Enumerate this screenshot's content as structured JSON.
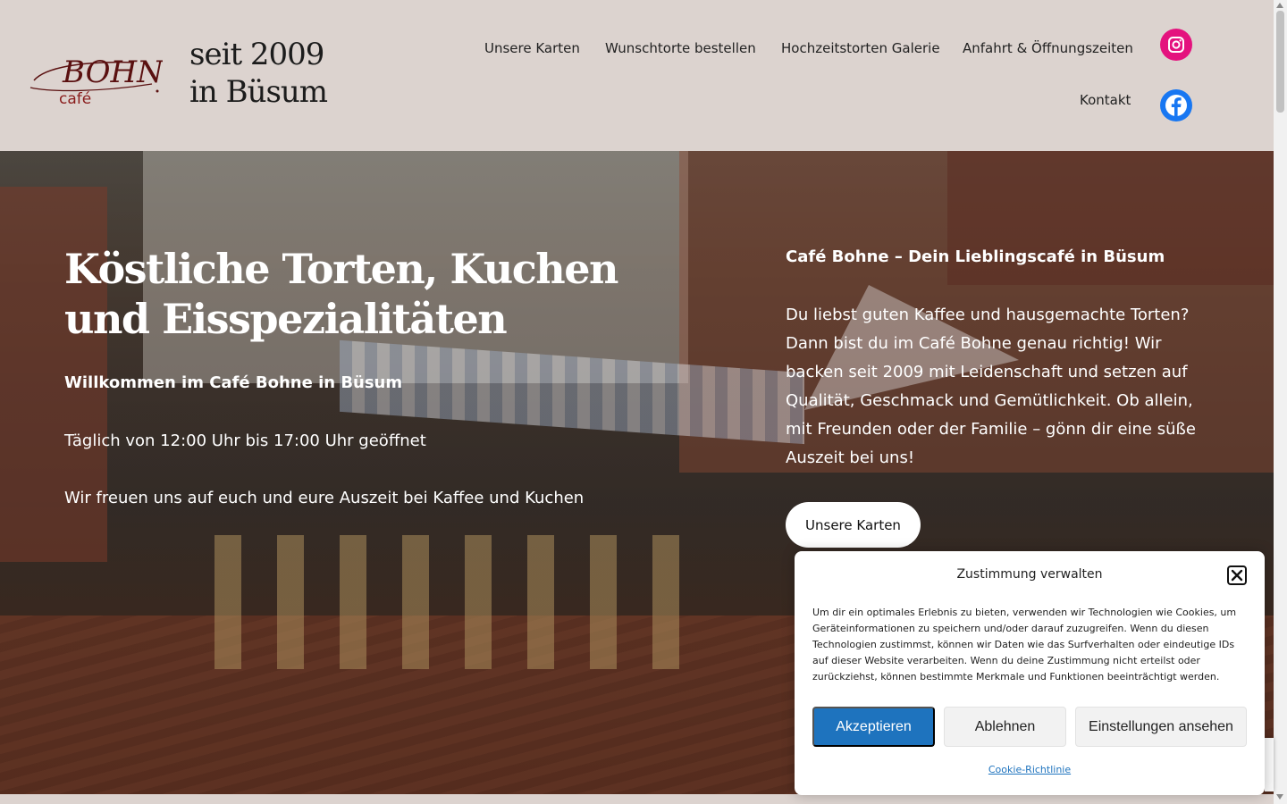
{
  "header": {
    "logo_main": "BOHNE",
    "logo_sub": "café",
    "tagline_line1": "seit 2009",
    "tagline_line2": "in Büsum"
  },
  "nav": {
    "items": [
      {
        "label": "Unsere Karten"
      },
      {
        "label": "Wunschtorte bestellen"
      },
      {
        "label": "Hochzeitstorten Galerie"
      },
      {
        "label": "Anfahrt & Öffnungszeiten"
      },
      {
        "label": "Kontakt"
      }
    ],
    "social": [
      {
        "icon": "instagram-icon",
        "color": "#e4127e"
      },
      {
        "icon": "facebook-icon",
        "color": "#1877f2"
      }
    ]
  },
  "hero": {
    "title_line1": "Köstliche Torten, Kuchen",
    "title_line2": "und Eisspezialitäten",
    "subtitle": "Willkommen im Café Bohne in Büsum",
    "hours": "Täglich von 12:00 Uhr bis 17:00 Uhr geöffnet",
    "welcome": "Wir freuen uns auf euch und eure Auszeit bei Kaffee und Kuchen",
    "right_title": "Café Bohne – Dein Lieblingscafé in Büsum",
    "right_text": "Du liebst guten Kaffee und hausgemachte Torten? Dann bist du im Café Bohne genau richtig! Wir backen seit 2009 mit Leidenschaft und setzen auf Qualität, Geschmack und Gemütlichkeit. Ob allein, mit Freunden oder der Familie – gönn dir eine süße Auszeit bei uns!",
    "button_label": "Unsere Karten"
  },
  "cookie": {
    "title": "Zustimmung verwalten",
    "text": "Um dir ein optimales Erlebnis zu bieten, verwenden wir Technologien wie Cookies, um Geräteinformationen zu speichern und/oder darauf zuzugreifen. Wenn du diesen Technologien zustimmst, können wir Daten wie das Surfverhalten oder eindeutige IDs auf dieser Website verarbeiten. Wenn du deine Zustimmung nicht erteilst oder zurückziehst, können bestimmte Merkmale und Funktionen beeinträchtigt werden.",
    "accept_label": "Akzeptieren",
    "deny_label": "Ablehnen",
    "prefs_label": "Einstellungen ansehen",
    "policy_label": "Cookie-Richtlinie",
    "accent_color": "#1e73be"
  },
  "colors": {
    "header_bg": "#dcd3cf",
    "logo_color": "#5a1010"
  }
}
